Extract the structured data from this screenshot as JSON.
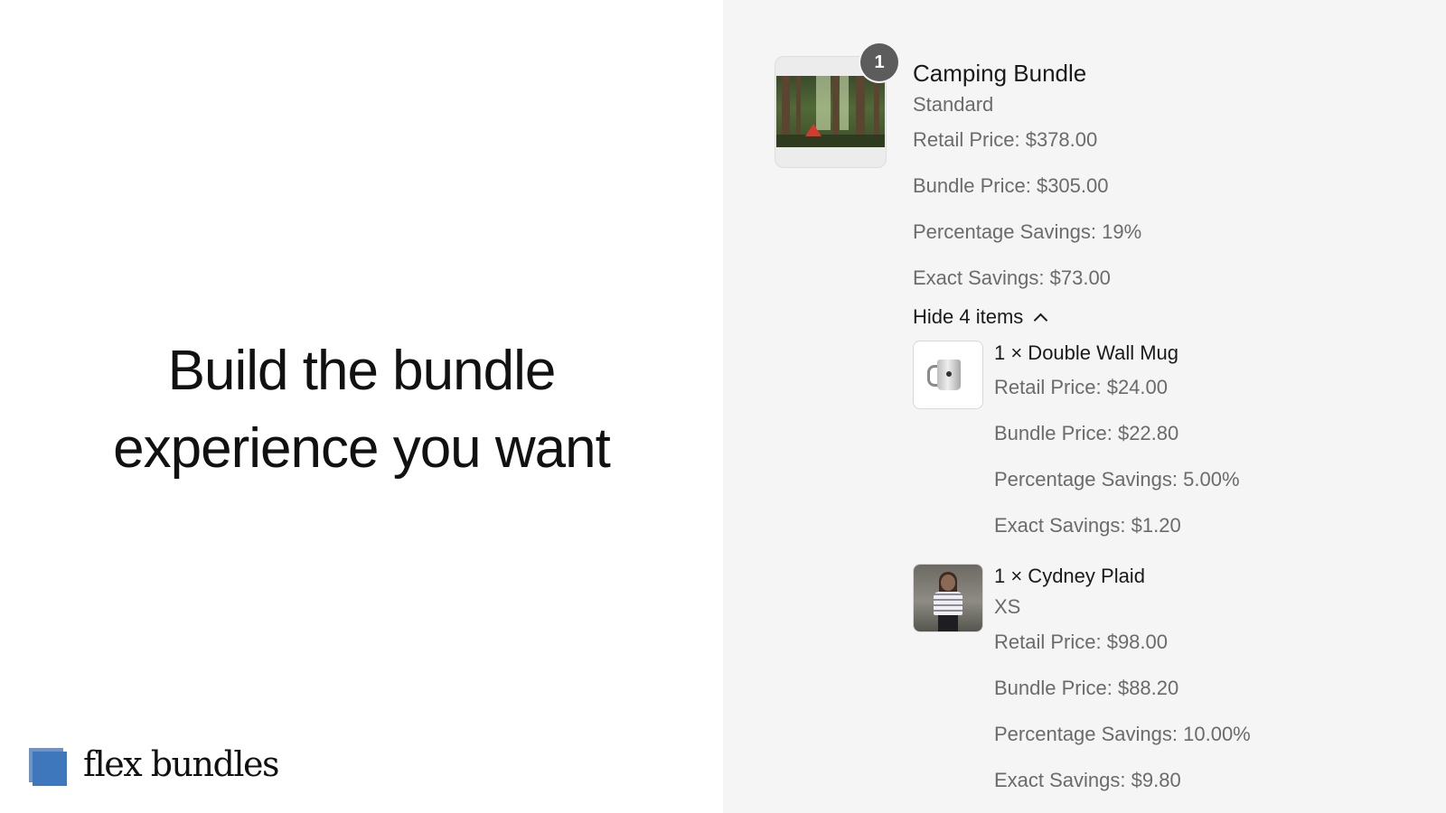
{
  "headline": {
    "line1": "Build the bundle",
    "line2": "experience you want"
  },
  "brand": {
    "name": "flex bundles",
    "colors": {
      "mark": "#3f77bd"
    }
  },
  "cart": {
    "bundle": {
      "quantity": "1",
      "title": "Camping Bundle",
      "variant": "Standard",
      "retail_price": "Retail Price: $378.00",
      "bundle_price": "Bundle Price: $305.00",
      "percentage_savings": "Percentage Savings: 19%",
      "exact_savings": "Exact Savings: $73.00",
      "toggle_label": "Hide 4 items"
    },
    "items": [
      {
        "title": "1 × Double Wall Mug",
        "retail_price": "Retail Price: $24.00",
        "bundle_price": "Bundle Price: $22.80",
        "percentage_savings": "Percentage Savings: 5.00%",
        "exact_savings": "Exact Savings: $1.20"
      },
      {
        "title": "1 × Cydney Plaid",
        "variant": "XS",
        "retail_price": "Retail Price: $98.00",
        "bundle_price": "Bundle Price: $88.20",
        "percentage_savings": "Percentage Savings: 10.00%",
        "exact_savings": "Exact Savings: $9.80"
      }
    ]
  }
}
